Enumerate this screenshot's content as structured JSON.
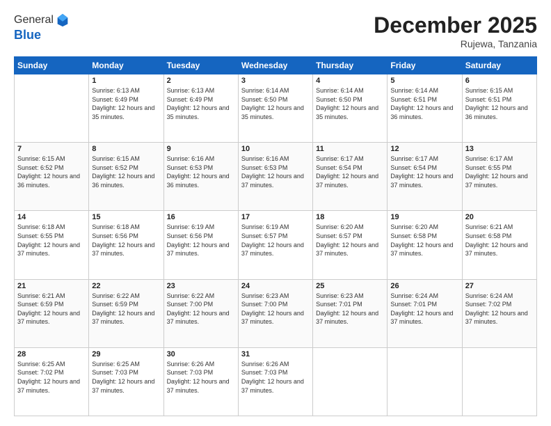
{
  "header": {
    "logo_general": "General",
    "logo_blue": "Blue",
    "month_title": "December 2025",
    "location": "Rujewa, Tanzania"
  },
  "days_of_week": [
    "Sunday",
    "Monday",
    "Tuesday",
    "Wednesday",
    "Thursday",
    "Friday",
    "Saturday"
  ],
  "weeks": [
    [
      {
        "day": "",
        "sunrise": "",
        "sunset": "",
        "daylight": ""
      },
      {
        "day": "1",
        "sunrise": "6:13 AM",
        "sunset": "6:49 PM",
        "daylight": "12 hours and 35 minutes."
      },
      {
        "day": "2",
        "sunrise": "6:13 AM",
        "sunset": "6:49 PM",
        "daylight": "12 hours and 35 minutes."
      },
      {
        "day": "3",
        "sunrise": "6:14 AM",
        "sunset": "6:50 PM",
        "daylight": "12 hours and 35 minutes."
      },
      {
        "day": "4",
        "sunrise": "6:14 AM",
        "sunset": "6:50 PM",
        "daylight": "12 hours and 35 minutes."
      },
      {
        "day": "5",
        "sunrise": "6:14 AM",
        "sunset": "6:51 PM",
        "daylight": "12 hours and 36 minutes."
      },
      {
        "day": "6",
        "sunrise": "6:15 AM",
        "sunset": "6:51 PM",
        "daylight": "12 hours and 36 minutes."
      }
    ],
    [
      {
        "day": "7",
        "sunrise": "6:15 AM",
        "sunset": "6:52 PM",
        "daylight": "12 hours and 36 minutes."
      },
      {
        "day": "8",
        "sunrise": "6:15 AM",
        "sunset": "6:52 PM",
        "daylight": "12 hours and 36 minutes."
      },
      {
        "day": "9",
        "sunrise": "6:16 AM",
        "sunset": "6:53 PM",
        "daylight": "12 hours and 36 minutes."
      },
      {
        "day": "10",
        "sunrise": "6:16 AM",
        "sunset": "6:53 PM",
        "daylight": "12 hours and 37 minutes."
      },
      {
        "day": "11",
        "sunrise": "6:17 AM",
        "sunset": "6:54 PM",
        "daylight": "12 hours and 37 minutes."
      },
      {
        "day": "12",
        "sunrise": "6:17 AM",
        "sunset": "6:54 PM",
        "daylight": "12 hours and 37 minutes."
      },
      {
        "day": "13",
        "sunrise": "6:17 AM",
        "sunset": "6:55 PM",
        "daylight": "12 hours and 37 minutes."
      }
    ],
    [
      {
        "day": "14",
        "sunrise": "6:18 AM",
        "sunset": "6:55 PM",
        "daylight": "12 hours and 37 minutes."
      },
      {
        "day": "15",
        "sunrise": "6:18 AM",
        "sunset": "6:56 PM",
        "daylight": "12 hours and 37 minutes."
      },
      {
        "day": "16",
        "sunrise": "6:19 AM",
        "sunset": "6:56 PM",
        "daylight": "12 hours and 37 minutes."
      },
      {
        "day": "17",
        "sunrise": "6:19 AM",
        "sunset": "6:57 PM",
        "daylight": "12 hours and 37 minutes."
      },
      {
        "day": "18",
        "sunrise": "6:20 AM",
        "sunset": "6:57 PM",
        "daylight": "12 hours and 37 minutes."
      },
      {
        "day": "19",
        "sunrise": "6:20 AM",
        "sunset": "6:58 PM",
        "daylight": "12 hours and 37 minutes."
      },
      {
        "day": "20",
        "sunrise": "6:21 AM",
        "sunset": "6:58 PM",
        "daylight": "12 hours and 37 minutes."
      }
    ],
    [
      {
        "day": "21",
        "sunrise": "6:21 AM",
        "sunset": "6:59 PM",
        "daylight": "12 hours and 37 minutes."
      },
      {
        "day": "22",
        "sunrise": "6:22 AM",
        "sunset": "6:59 PM",
        "daylight": "12 hours and 37 minutes."
      },
      {
        "day": "23",
        "sunrise": "6:22 AM",
        "sunset": "7:00 PM",
        "daylight": "12 hours and 37 minutes."
      },
      {
        "day": "24",
        "sunrise": "6:23 AM",
        "sunset": "7:00 PM",
        "daylight": "12 hours and 37 minutes."
      },
      {
        "day": "25",
        "sunrise": "6:23 AM",
        "sunset": "7:01 PM",
        "daylight": "12 hours and 37 minutes."
      },
      {
        "day": "26",
        "sunrise": "6:24 AM",
        "sunset": "7:01 PM",
        "daylight": "12 hours and 37 minutes."
      },
      {
        "day": "27",
        "sunrise": "6:24 AM",
        "sunset": "7:02 PM",
        "daylight": "12 hours and 37 minutes."
      }
    ],
    [
      {
        "day": "28",
        "sunrise": "6:25 AM",
        "sunset": "7:02 PM",
        "daylight": "12 hours and 37 minutes."
      },
      {
        "day": "29",
        "sunrise": "6:25 AM",
        "sunset": "7:03 PM",
        "daylight": "12 hours and 37 minutes."
      },
      {
        "day": "30",
        "sunrise": "6:26 AM",
        "sunset": "7:03 PM",
        "daylight": "12 hours and 37 minutes."
      },
      {
        "day": "31",
        "sunrise": "6:26 AM",
        "sunset": "7:03 PM",
        "daylight": "12 hours and 37 minutes."
      },
      {
        "day": "",
        "sunrise": "",
        "sunset": "",
        "daylight": ""
      },
      {
        "day": "",
        "sunrise": "",
        "sunset": "",
        "daylight": ""
      },
      {
        "day": "",
        "sunrise": "",
        "sunset": "",
        "daylight": ""
      }
    ]
  ]
}
